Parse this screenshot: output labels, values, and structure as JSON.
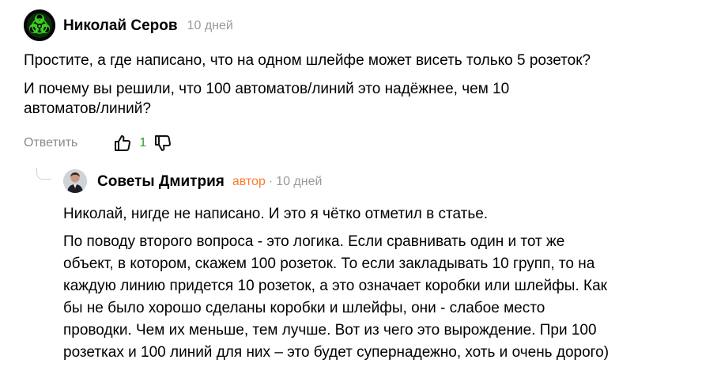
{
  "comment": {
    "author": "Николай Серов",
    "time": "10 дней",
    "paragraphs": [
      "Простите, а где написано, что на одном шлейфе может висеть только 5 розеток?",
      "И почему вы решили, что 100 автоматов/линий это надёжнее, чем 10 автоматов/линий?"
    ],
    "reply_label": "Ответить",
    "like_count": "1"
  },
  "reply": {
    "author": "Советы Дмитрия",
    "badge": "автор",
    "separator": "·",
    "time": "10 дней",
    "paragraphs": [
      "Николай, нигде не написано. И это я чётко отметил в статье.",
      "По поводу второго вопроса - это логика. Если сравнивать один и тот же объект, в котором, скажем 100 розеток. То если закладывать 10 групп, то на каждую линию придется 10 розеток, а это означает коробки или шлейфы. Как бы не было хорошо сделаны коробки и шлейфы, они - слабое место проводки. Чем их меньше, тем лучше. Вот из чего это вырождение. При 100 розетках и 100 линий для них – это будет супернадежно, хоть и очень дорого)"
    ]
  },
  "colors": {
    "likes": "#2d9b2d",
    "author_badge": "#ff7a2f",
    "muted": "#9a9a9a"
  },
  "icons": {
    "main_avatar": "biohazard-avatar-icon",
    "reply_avatar": "person-avatar-icon",
    "like": "thumbs-up-icon",
    "dislike": "thumbs-down-icon"
  }
}
